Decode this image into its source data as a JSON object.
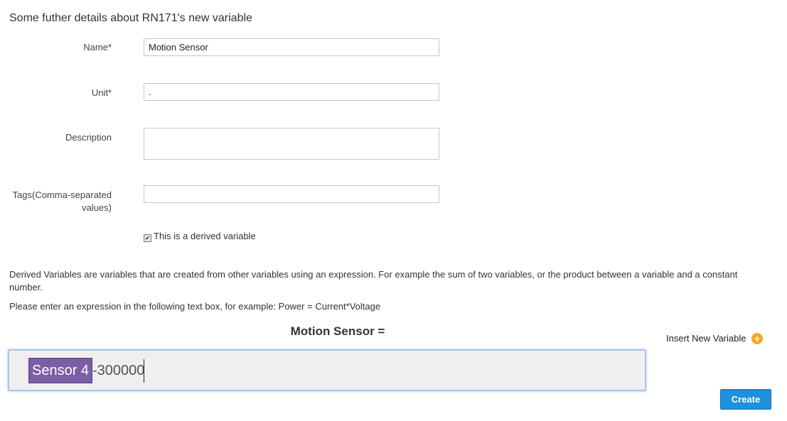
{
  "heading": "Some futher details about RN171's new variable",
  "form": {
    "name_label": "Name*",
    "name_value": "Motion Sensor",
    "unit_label": "Unit*",
    "unit_value": ".",
    "description_label": "Description",
    "description_value": "",
    "tags_label_line1": "Tags(Comma-separated",
    "tags_label_line2": "values)",
    "tags_value": "",
    "derived_checkbox_checked": true,
    "derived_label": "This is a derived variable"
  },
  "info": {
    "derived_explanation": "Derived Variables are variables that are created from other variables using an expression. For example the sum of two variables, or the product between a variable and a constant number.",
    "example_text": "Please enter an expression in the following text box, for example: Power = Current*Voltage"
  },
  "expression": {
    "title": "Motion Sensor =",
    "insert_label": "Insert New Variable",
    "insert_icon": "plus-circle-icon",
    "variable_chip": "Sensor 4",
    "text": "-300000"
  },
  "actions": {
    "create_label": "Create"
  },
  "colors": {
    "chip": "#7b5ea6",
    "create_button": "#1f8fde",
    "insert_icon": "#f5a623"
  }
}
